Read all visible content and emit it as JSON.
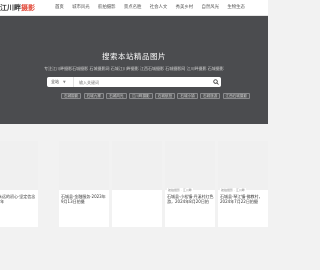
{
  "site": {
    "logo_text_a": "江川畔",
    "logo_text_b": "摄影"
  },
  "nav": {
    "items": [
      {
        "label": "首页",
        "active": true
      },
      {
        "label": "城市风光"
      },
      {
        "label": "航拍摄影"
      },
      {
        "label": "景点名胜"
      },
      {
        "label": "社会人文"
      },
      {
        "label": "秀美乡村"
      },
      {
        "label": "自然风光"
      },
      {
        "label": "生物生态"
      }
    ]
  },
  "hero": {
    "title": "搜索本站精品图片",
    "subtitle": "专注江川畔摄影石城摄影 石城摄影网 石城江川畔摄影 江西石城摄影 石城摄影网 江川畔摄影 石城摄影",
    "search": {
      "select_value": "全站",
      "placeholder": "输入关键词"
    },
    "tags": [
      "石城摄影",
      "石城九寨",
      "石城风光",
      "江川畔摄影",
      "石城航拍",
      "石城小镇",
      "石城旅游",
      "江西石城摄影"
    ]
  },
  "cards": [
    {
      "category": "",
      "title": "本，永远的初心·坚定信念2024年",
      "views": "",
      "date": ""
    },
    {
      "category": "",
      "title": "石城县·金融服务·2023年9月13日拍摄",
      "views": "",
      "date": ""
    },
    {
      "category": "",
      "title": "",
      "views": "",
      "date": ""
    },
    {
      "category": "航拍摄影 · 江川畔",
      "title": "石城县·小松镇·丹溪村红色游，2024年8月20日拍",
      "views": "",
      "date": ""
    },
    {
      "category": "航拍摄影 · 江川畔",
      "title": "石城县·琴江镇·佛教村，2024年7月22日拍摄",
      "views": "",
      "date": ""
    }
  ]
}
